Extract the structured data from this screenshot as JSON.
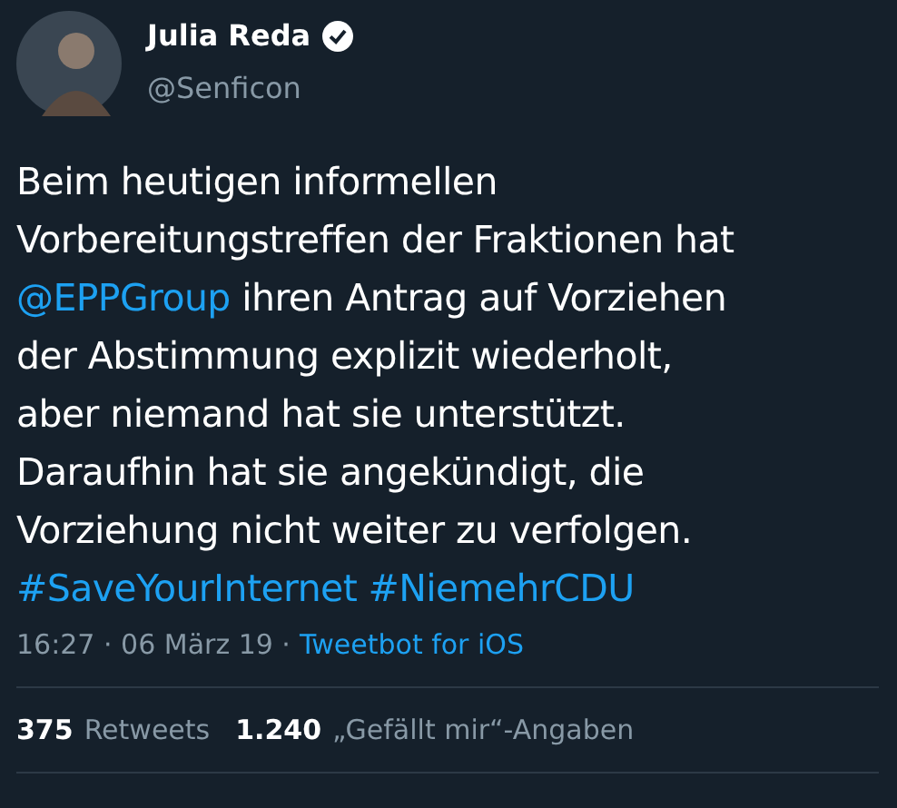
{
  "author": {
    "name": "Julia Reda",
    "verified": true,
    "handle": "@Senficon"
  },
  "text_lines": [
    [
      {
        "kind": "text",
        "text": "Beim heutigen informellen"
      }
    ],
    [
      {
        "kind": "text",
        "text": "Vorbereitungstreffen der Fraktionen hat"
      }
    ],
    [
      {
        "kind": "link",
        "text": "@EPPGroup"
      },
      {
        "kind": "text",
        "text": " ihren Antrag auf Vorziehen"
      }
    ],
    [
      {
        "kind": "text",
        "text": "der Abstimmung explizit wiederholt,"
      }
    ],
    [
      {
        "kind": "text",
        "text": "aber niemand hat sie unterstützt."
      }
    ],
    [
      {
        "kind": "text",
        "text": "Daraufhin hat sie angekündigt, die"
      }
    ],
    [
      {
        "kind": "text",
        "text": "Vorziehung nicht weiter zu verfolgen."
      }
    ],
    [
      {
        "kind": "link",
        "text": "#SaveYourInternet"
      },
      {
        "kind": "link",
        "text": "#NiemehrCDU"
      }
    ]
  ],
  "meta": {
    "time": "16:27 · 06 März 19 ·",
    "source": "Tweetbot for iOS"
  },
  "stats": [
    {
      "count": "375",
      "label": "Retweets"
    },
    {
      "count": "1.240",
      "label": "„Gefällt mir“-Angaben"
    }
  ]
}
